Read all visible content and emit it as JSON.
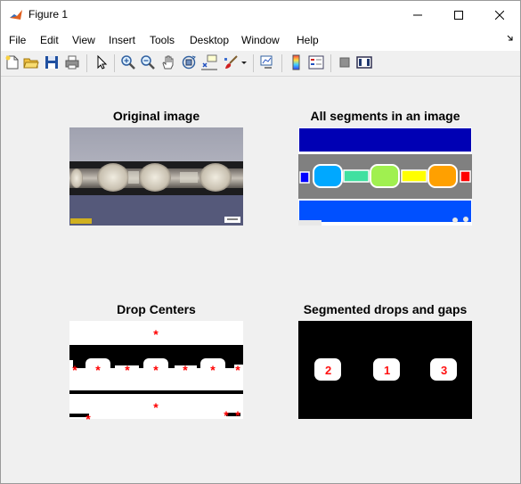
{
  "window": {
    "title": "Figure 1",
    "minimize_icon": "minimize-icon",
    "maximize_icon": "maximize-icon",
    "close_icon": "close-icon"
  },
  "menu": {
    "items": [
      "File",
      "Edit",
      "View",
      "Insert",
      "Tools",
      "Desktop",
      "Window",
      "Help"
    ]
  },
  "toolbar": {
    "icons": [
      "new-figure-icon",
      "open-file-icon",
      "save-icon",
      "print-icon",
      "pointer-icon",
      "zoom-in-icon",
      "zoom-out-icon",
      "pan-icon",
      "rotate-3d-icon",
      "data-cursor-icon",
      "brush-icon",
      "brush-dropdown-icon",
      "link-plot-icon",
      "colorbar-icon",
      "legend-icon",
      "hide-plot-tools-icon",
      "show-plot-tools-icon"
    ]
  },
  "plots": {
    "original": {
      "title": "Original image"
    },
    "segments": {
      "title": "All segments in an image",
      "colors": [
        "#0000b4",
        "#808080",
        "#0050ff",
        "#0000ff",
        "#00a8ff",
        "#40e0a0",
        "#a0f050",
        "#ffff00",
        "#ffa000",
        "#ff0000"
      ]
    },
    "centers": {
      "title": "Drop Centers",
      "marker_color": "#ff0000"
    },
    "segmented": {
      "title": "Segmented drops and gaps",
      "labels": [
        "2",
        "1",
        "3"
      ]
    }
  }
}
